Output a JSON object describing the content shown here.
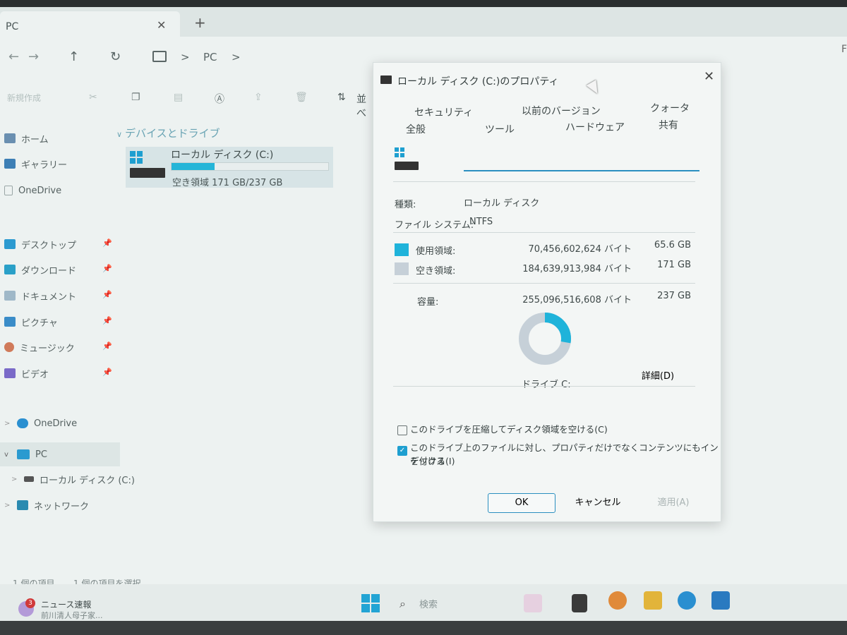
{
  "window": {
    "tab_title": "PC",
    "tab_close": "✕",
    "tab_new": "+",
    "far_right_char": "F"
  },
  "nav": {
    "back": "←",
    "forward": "→",
    "up": "↑",
    "refresh": "↻",
    "sep": ">",
    "path": "PC"
  },
  "toolbar": {
    "new_label": "新規作成",
    "sort_label": "並べ"
  },
  "sidebar": {
    "items": [
      {
        "label": "ホーム",
        "color": "#6a8fb0"
      },
      {
        "label": "ギャラリー",
        "color": "#3d7fb5"
      },
      {
        "label": "OneDrive",
        "color": "#c8d0d0"
      },
      {
        "label": "デスクトップ",
        "color": "#2b9ad0"
      },
      {
        "label": "ダウンロード",
        "color": "#2aa0c8"
      },
      {
        "label": "ドキュメント",
        "color": "#9fb8c8"
      },
      {
        "label": "ピクチャ",
        "color": "#3a8cc8"
      },
      {
        "label": "ミュージック",
        "color": "#d07a5a"
      },
      {
        "label": "ビデオ",
        "color": "#7a6ac8"
      }
    ],
    "tree": [
      {
        "label": "OneDrive",
        "expander": ">",
        "color": "#2a8fd0"
      },
      {
        "label": "PC",
        "expander": "v",
        "color": "#2a9ad0"
      },
      {
        "label": "ローカル ディスク (C:)",
        "expander": ">",
        "color": "#444"
      },
      {
        "label": "ネットワーク",
        "expander": ">",
        "color": "#2a8ab0"
      }
    ]
  },
  "content": {
    "section_title": "デバイスとドライブ",
    "drive": {
      "name": "ローカル ディスク (C:)",
      "space": "空き領域 171 GB/237 GB",
      "used_fraction": 0.277
    }
  },
  "status": {
    "items_count": "1 個の項目",
    "selected": "1 個の項目を選択"
  },
  "taskbar": {
    "news_badge": "3",
    "news_title": "ニュース速報",
    "news_sub": "前川清人母子家...",
    "search_label": "検索"
  },
  "dialog": {
    "title": "ローカル ディスク (C:)のプロパティ",
    "close": "✕",
    "tabs_row1": [
      "セキュリティ",
      "以前のバージョン",
      "クォータ"
    ],
    "tabs_row2": [
      "全般",
      "ツール",
      "ハードウェア",
      "共有"
    ],
    "name_value": "",
    "type_label": "種類:",
    "type_value": "ローカル ディスク",
    "fs_label": "ファイル システム:",
    "fs_value": "NTFS",
    "used_label": "使用領域:",
    "used_bytes": "70,456,602,624 バイト",
    "used_gb": "65.6 GB",
    "free_label": "空き領域:",
    "free_bytes": "184,639,913,984 バイト",
    "free_gb": "171 GB",
    "capacity_label": "容量:",
    "capacity_bytes": "255,096,516,608 バイト",
    "capacity_gb": "237 GB",
    "used_color": "#1fb3da",
    "free_color": "#c6d0d8",
    "used_fraction": 0.277,
    "drive_label": "ドライブ C:",
    "details_button": "詳細(D)",
    "compress_label": "このドライブを圧縮してディスク領域を空ける(C)",
    "compress_checked": false,
    "index_label_line1": "このドライブ上のファイルに対し、プロパティだけでなくコンテンツにもインデックス",
    "index_label_line2": "を付ける(I)",
    "index_checked": true,
    "ok": "OK",
    "cancel": "キャンセル",
    "apply": "適用(A)"
  }
}
